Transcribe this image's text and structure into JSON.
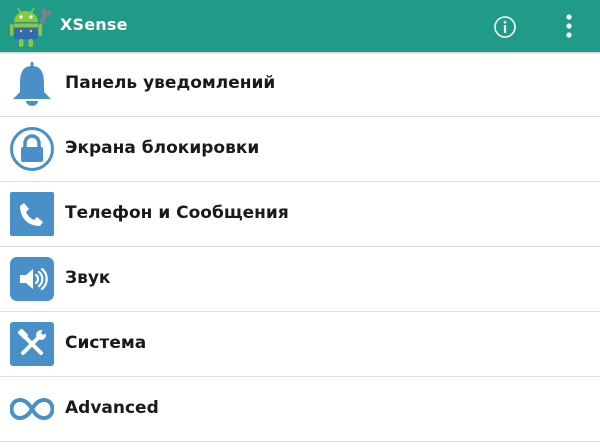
{
  "app_bar": {
    "title": "XSense",
    "logo_icon": "android-robot-wrench-icon",
    "info_icon": "info-circle-icon",
    "overflow_icon": "more-vert-icon",
    "background_color": "#1f9b88"
  },
  "menu": {
    "icon_color": "#4a90c8",
    "items": [
      {
        "label": "Панель уведомлений",
        "icon": "bell-icon"
      },
      {
        "label": "Экрана блокировки",
        "icon": "lock-icon"
      },
      {
        "label": "Телефон и Сообщения",
        "icon": "phone-icon"
      },
      {
        "label": "Звук",
        "icon": "speaker-icon"
      },
      {
        "label": "Система",
        "icon": "tools-icon"
      },
      {
        "label": "Advanced",
        "icon": "infinity-icon"
      }
    ]
  }
}
